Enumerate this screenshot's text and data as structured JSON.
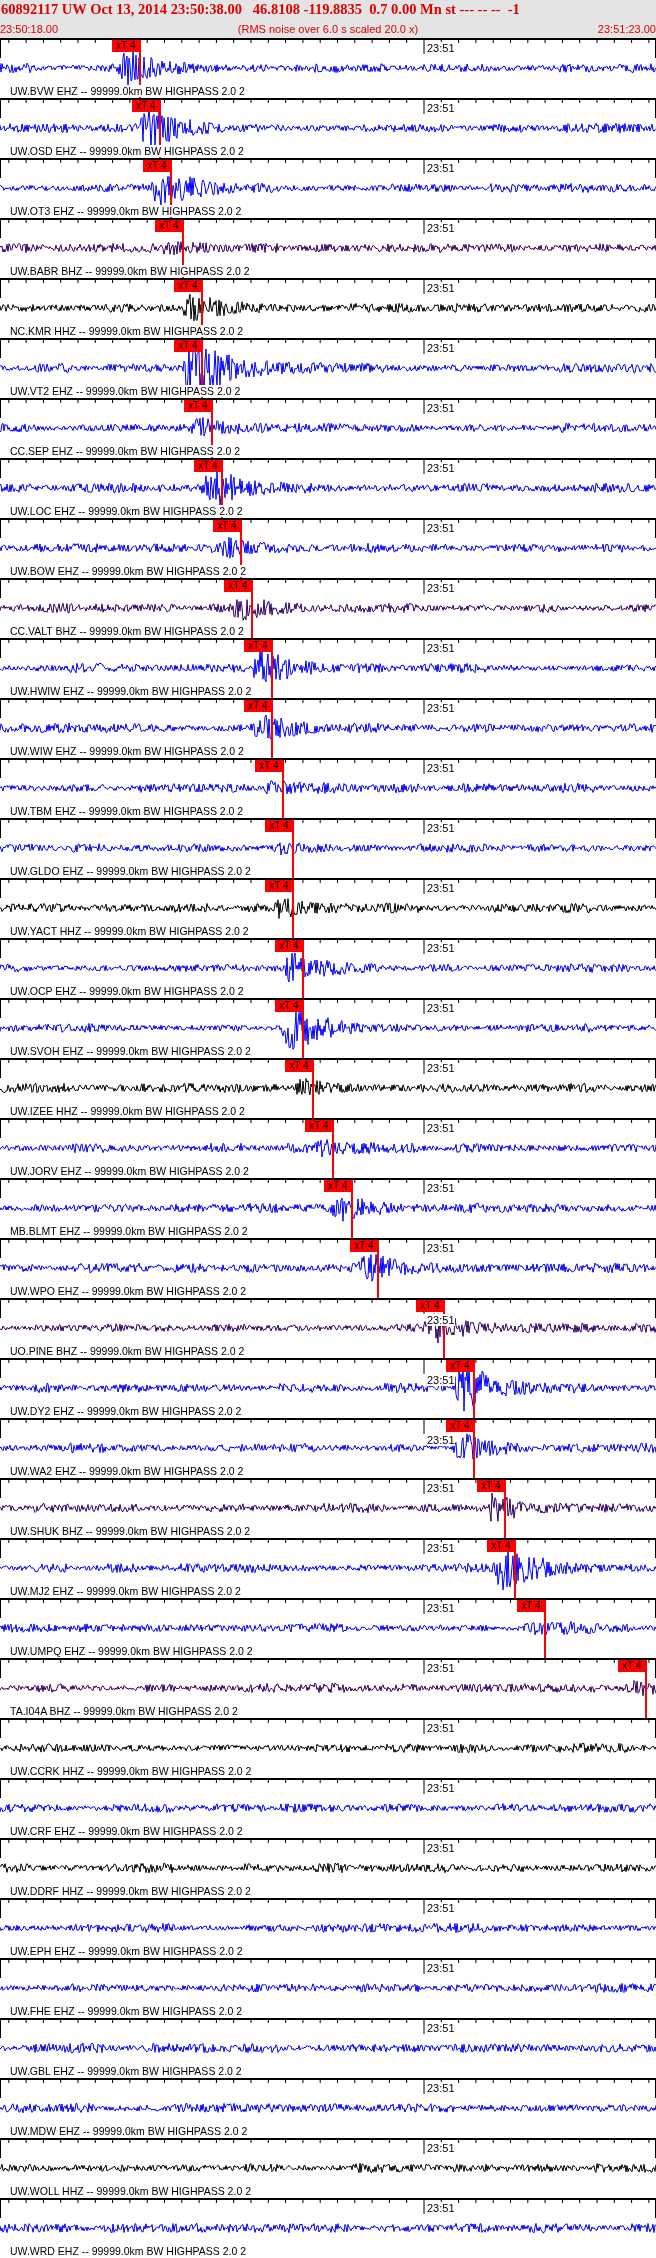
{
  "header": {
    "title": "60892117 UW Oct 13, 2014 23:50:38.00   46.8108 -119.8835  0.7 0.00 Mn st --- -- --  -1",
    "start_time": "23:50:18.00",
    "note": "(RMS noise over 6.0 s scaled 20.0 x)",
    "end_time": "23:51:23.00"
  },
  "traces": [
    {
      "pick": "xT 4",
      "minute_label": "23:51",
      "label": "UW.BVW EHZ -- 99999.0km BW HIGHPASS 2.0 2",
      "color": "#0000ff"
    },
    {
      "pick": "xT 4",
      "minute_label": "23:51",
      "label": "UW.OSD EHZ -- 99999.0km BW HIGHPASS 2.0 2",
      "color": "#0000ff"
    },
    {
      "pick": "xT 4",
      "minute_label": "23:51",
      "label": "UW.OT3 EHZ -- 99999.0km BW HIGHPASS 2.0 2",
      "color": "#0000ff"
    },
    {
      "pick": "xT 4",
      "minute_label": "23:51",
      "label": "UW.BABR BHZ -- 99999.0km BW HIGHPASS 2.0 2",
      "color": "#330066"
    },
    {
      "pick": "xT 4",
      "minute_label": "23:51",
      "label": "NC.KMR HHZ -- 99999.0km BW HIGHPASS 2.0 2",
      "color": "#000000"
    },
    {
      "pick": "xT 4",
      "minute_label": "23:51",
      "label": "UW.VT2 EHZ -- 99999.0km BW HIGHPASS 2.0 2",
      "color": "#0000ff"
    },
    {
      "pick": "xT 4",
      "minute_label": "23:51",
      "label": "CC.SEP EHZ -- 99999.0km BW HIGHPASS 2.0 2",
      "color": "#0000ff"
    },
    {
      "pick": "xT 4",
      "minute_label": "23:51",
      "label": "UW.LOC EHZ -- 99999.0km BW HIGHPASS 2.0 2",
      "color": "#0000ff"
    },
    {
      "pick": "xT 4",
      "minute_label": "23:51",
      "label": "UW.BOW EHZ -- 99999.0km BW HIGHPASS 2.0 2",
      "color": "#0000ff"
    },
    {
      "pick": "xT 4",
      "minute_label": "23:51",
      "label": "CC.VALT BHZ -- 99999.0km BW HIGHPASS 2.0 2",
      "color": "#330066"
    },
    {
      "pick": "xT 4",
      "minute_label": "23:51",
      "label": "UW.HWIW EHZ -- 99999.0km BW HIGHPASS 2.0 2",
      "color": "#0000ff"
    },
    {
      "pick": "xT 4",
      "minute_label": "23:51",
      "label": "UW.WIW EHZ -- 99999.0km BW HIGHPASS 2.0 2",
      "color": "#0000ff"
    },
    {
      "pick": "xT 4",
      "minute_label": "23:51",
      "label": "UW.TBM EHZ -- 99999.0km BW HIGHPASS 2.0 2",
      "color": "#0000ff"
    },
    {
      "pick": "xT 4",
      "minute_label": "23:51",
      "label": "UW.GLDO EHZ -- 99999.0km BW HIGHPASS 2.0 2",
      "color": "#0000ff"
    },
    {
      "pick": "xT 4",
      "minute_label": "23:51",
      "label": "UW.YACT HHZ -- 99999.0km BW HIGHPASS 2.0 2",
      "color": "#000000"
    },
    {
      "pick": "xT 4",
      "minute_label": "23:51",
      "label": "UW.OCP EHZ -- 99999.0km BW HIGHPASS 2.0 2",
      "color": "#0000ff"
    },
    {
      "pick": "xT 4",
      "minute_label": "23:51",
      "label": "UW.SVOH EHZ -- 99999.0km BW HIGHPASS 2.0 2",
      "color": "#0000ff"
    },
    {
      "pick": "xT 4",
      "minute_label": "23:51",
      "label": "UW.IZEE HHZ -- 99999.0km BW HIGHPASS 2.0 2",
      "color": "#000000"
    },
    {
      "pick": "xT 4",
      "minute_label": "23:51",
      "label": "UW.JORV EHZ -- 99999.0km BW HIGHPASS 2.0 2",
      "color": "#0000ff"
    },
    {
      "pick": "xT 4",
      "minute_label": "23:51",
      "label": "MB.BLMT EHZ -- 99999.0km BW HIGHPASS 2.0 2",
      "color": "#0000ff"
    },
    {
      "pick": "xT 4",
      "minute_label": "23:51",
      "label": "UW.WPO EHZ -- 99999.0km BW HIGHPASS 2.0 2",
      "color": "#0000ff"
    },
    {
      "pick": "xT 4",
      "minute_label": "23:51",
      "label": "UO.PINE BHZ -- 99999.0km BW HIGHPASS 2.0 2",
      "color": "#330066"
    },
    {
      "pick": "xT 4",
      "minute_label": "23:51",
      "label": "UW.DY2 EHZ -- 99999.0km BW HIGHPASS 2.0 2",
      "color": "#0000ff"
    },
    {
      "pick": "xT 4",
      "minute_label": "23:51",
      "label": "UW.WA2 EHZ -- 99999.0km BW HIGHPASS 2.0 2",
      "color": "#0000ff"
    },
    {
      "pick": "xT 4",
      "minute_label": "23:51",
      "label": "UW.SHUK BHZ -- 99999.0km BW HIGHPASS 2.0 2",
      "color": "#330066"
    },
    {
      "pick": "xT 4",
      "minute_label": "23:51",
      "label": "UW.MJ2 EHZ -- 99999.0km BW HIGHPASS 2.0 2",
      "color": "#0000ff"
    },
    {
      "pick": "xT 4",
      "minute_label": "23:51",
      "label": "UW.UMPQ EHZ -- 99999.0km BW HIGHPASS 2.0 2",
      "color": "#0000ff"
    },
    {
      "pick": "xT 4",
      "minute_label": "23:51",
      "label": "TA.I04A BHZ -- 99999.0km BW HIGHPASS 2.0 2",
      "color": "#330066"
    },
    {
      "minute_label": "23:51",
      "label": "UW.CCRK HHZ -- 99999.0km BW HIGHPASS 2.0 2",
      "color": "#000000"
    },
    {
      "minute_label": "23:51",
      "label": "UW.CRF EHZ -- 99999.0km BW HIGHPASS 2.0 2",
      "color": "#0000ff"
    },
    {
      "minute_label": "23:51",
      "label": "UW.DDRF HHZ -- 99999.0km BW HIGHPASS 2.0 2",
      "color": "#000000"
    },
    {
      "minute_label": "23:51",
      "label": "UW.EPH EHZ -- 99999.0km BW HIGHPASS 2.0 2",
      "color": "#0000ff"
    },
    {
      "minute_label": "23:51",
      "label": "UW.FHE EHZ -- 99999.0km BW HIGHPASS 2.0 2",
      "color": "#0000ff"
    },
    {
      "minute_label": "23:51",
      "label": "UW.GBL EHZ -- 99999.0km BW HIGHPASS 2.0 2",
      "color": "#0000ff"
    },
    {
      "minute_label": "23:51",
      "label": "UW.MDW EHZ -- 99999.0km BW HIGHPASS 2.0 2",
      "color": "#0000ff"
    },
    {
      "minute_label": "23:51",
      "label": "UW.WOLL HHZ -- 99999.0km BW HIGHPASS 2.0 2",
      "color": "#000000"
    },
    {
      "minute_label": "23:51",
      "label": "UW.WRD EHZ -- 99999.0km BW HIGHPASS 2.0 2",
      "color": "#0000ff"
    }
  ]
}
